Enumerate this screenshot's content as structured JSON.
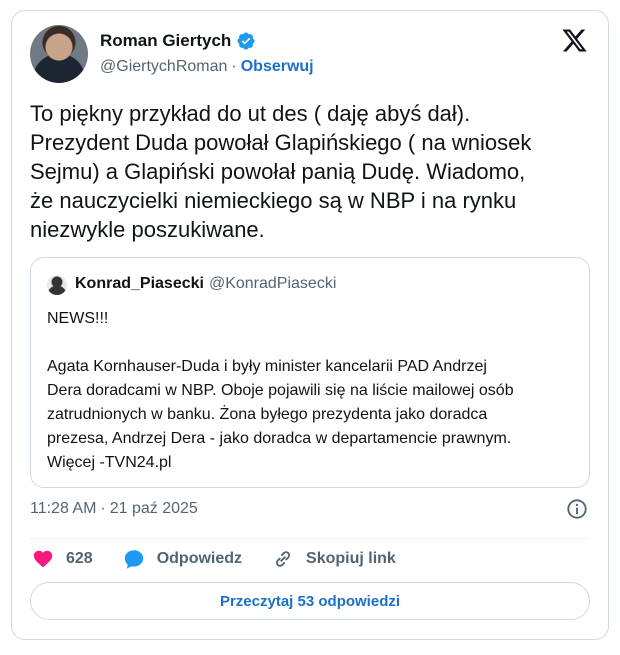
{
  "author": {
    "name": "Roman Giertych",
    "handle": "@GiertychRoman",
    "separator": "·",
    "follow_label": "Obserwuj"
  },
  "tweet_text": "To piękny przykład do ut des ( daję abyś dał).\nPrezydent Duda powołał Glapińskiego ( na wniosek\nSejmu) a Glapiński powołał panią Dudę. Wiadomo,\nże nauczycielki niemieckiego są w NBP i na rynku\nniezwykle poszukiwane.",
  "quoted": {
    "name": "Konrad_Piasecki",
    "handle": "@KonradPiasecki",
    "text": "NEWS!!!\n\nAgata Kornhauser-Duda i były minister kancelarii PAD Andrzej\nDera doradcami w NBP. Oboje pojawili się na liście mailowej osób\nzatrudnionych w banku. Żona byłego prezydenta jako doradca\nprezesa, Andrzej Dera - jako doradca w departamencie prawnym.\nWięcej -TVN24.pl"
  },
  "meta": {
    "time": "11:28 AM",
    "separator": "·",
    "date": "21 paź 2025"
  },
  "actions": {
    "likes_count": "628",
    "reply_label": "Odpowiedz",
    "copy_label": "Skopiuj link"
  },
  "read_replies_label": "Przeczytaj 53 odpowiedzi",
  "colors": {
    "accent": "#1d70c9",
    "verified": "#1d9bf0",
    "like": "#f91880",
    "reply": "#1d9bf0"
  },
  "icons": [
    "avatar",
    "verified-badge-icon",
    "x-logo-icon",
    "info-icon",
    "heart-icon",
    "reply-bubble-icon",
    "link-icon"
  ]
}
